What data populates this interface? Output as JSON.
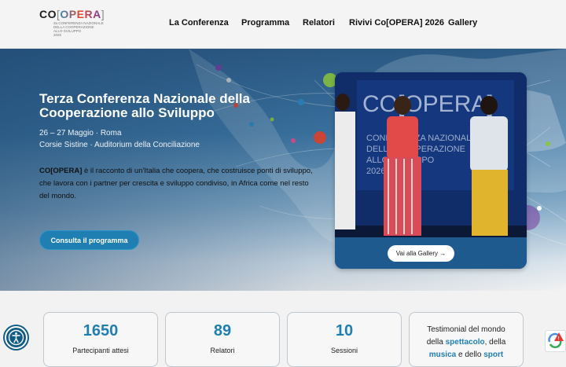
{
  "logo": {
    "main_prefix": "CO",
    "main_open": "[",
    "main_word": "OPERA",
    "main_close": "]",
    "sub_lines": [
      "3a CONFERENZA NAZIONALE",
      "DELLA COOPERAZIONE",
      "ALLO SVILUPPO",
      "2026"
    ]
  },
  "nav": {
    "items": [
      "La Conferenza",
      "Programma",
      "Relatori",
      "Rivivi Co[OPERA] 2026",
      "Gallery"
    ]
  },
  "hero": {
    "title": "Terza Conferenza Nazionale della Cooperazione allo Sviluppo",
    "date": "26 – 27 Maggio · Roma",
    "place": "Corsie Sistine · Auditorium della Conciliazione",
    "desc_bold": "CO[OPERA]",
    "desc_rest": " è il racconto di un'Italia che coopera, che costruisce ponti di sviluppo, che lavora con i partner per crescita e sviluppo condiviso, in Africa come nel resto del mondo.",
    "cta_label": "Consulta il programma"
  },
  "photo": {
    "screen_text": "CO[OPERA]",
    "screen_sub": [
      "CONFERENZA NAZIONALE",
      "DELLA COOPERAZIONE",
      "ALLO SVILUPPO",
      "2026"
    ],
    "gallery_button": "Vai alla Gallery →"
  },
  "stats": [
    {
      "value": "1650",
      "label": "Partecipanti attesi"
    },
    {
      "value": "89",
      "label": "Relatori"
    },
    {
      "value": "10",
      "label": "Sessioni"
    }
  ],
  "testimonial": {
    "t1": "Testimonial del mondo",
    "t2a": "della ",
    "t2b": "spettacolo",
    "t2c": ", della",
    "t3a": "musica",
    "t3b": " e dello ",
    "t3c": "sport"
  },
  "colors": {
    "accent": "#1f7fb3",
    "hero_top": "#2c5b86",
    "card_border": "#bfc7cf"
  },
  "icons": {
    "accessibility": "accessibility-icon",
    "recaptcha": "recaptcha-icon"
  }
}
